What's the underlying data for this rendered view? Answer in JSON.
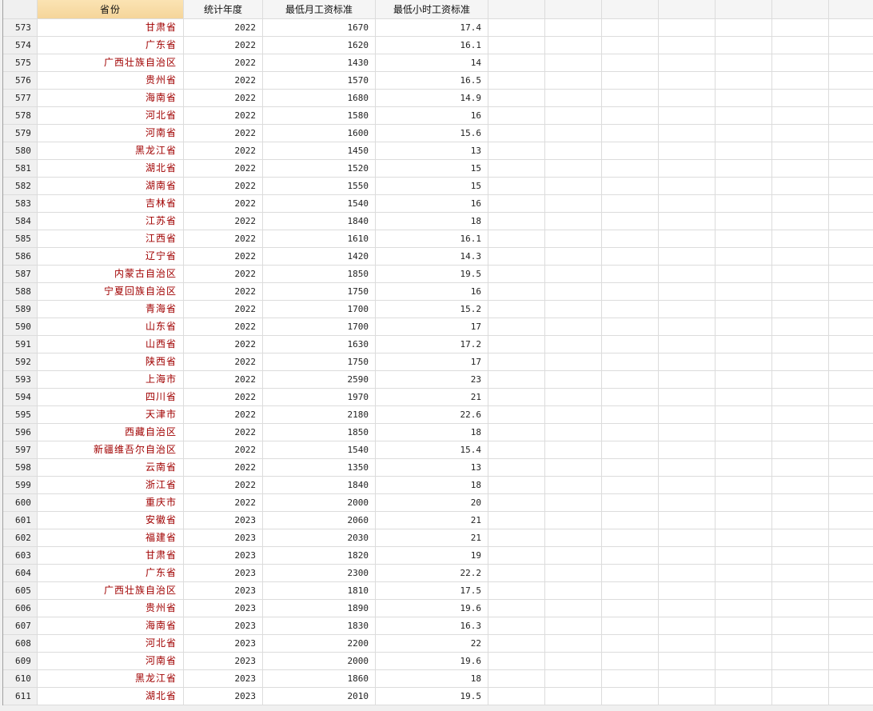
{
  "columns": [
    "省份",
    "统计年度",
    "最低月工资标准",
    "最低小时工资标准"
  ],
  "selected_column": 0,
  "empty_columns": 7,
  "colors": {
    "province_text": "#a00000",
    "selected_header": "#f8dca6"
  },
  "rows": [
    [
      "573",
      "甘肃省",
      "2022",
      "1670",
      "17.4"
    ],
    [
      "574",
      "广东省",
      "2022",
      "1620",
      "16.1"
    ],
    [
      "575",
      "广西壮族自治区",
      "2022",
      "1430",
      "14"
    ],
    [
      "576",
      "贵州省",
      "2022",
      "1570",
      "16.5"
    ],
    [
      "577",
      "海南省",
      "2022",
      "1680",
      "14.9"
    ],
    [
      "578",
      "河北省",
      "2022",
      "1580",
      "16"
    ],
    [
      "579",
      "河南省",
      "2022",
      "1600",
      "15.6"
    ],
    [
      "580",
      "黑龙江省",
      "2022",
      "1450",
      "13"
    ],
    [
      "581",
      "湖北省",
      "2022",
      "1520",
      "15"
    ],
    [
      "582",
      "湖南省",
      "2022",
      "1550",
      "15"
    ],
    [
      "583",
      "吉林省",
      "2022",
      "1540",
      "16"
    ],
    [
      "584",
      "江苏省",
      "2022",
      "1840",
      "18"
    ],
    [
      "585",
      "江西省",
      "2022",
      "1610",
      "16.1"
    ],
    [
      "586",
      "辽宁省",
      "2022",
      "1420",
      "14.3"
    ],
    [
      "587",
      "内蒙古自治区",
      "2022",
      "1850",
      "19.5"
    ],
    [
      "588",
      "宁夏回族自治区",
      "2022",
      "1750",
      "16"
    ],
    [
      "589",
      "青海省",
      "2022",
      "1700",
      "15.2"
    ],
    [
      "590",
      "山东省",
      "2022",
      "1700",
      "17"
    ],
    [
      "591",
      "山西省",
      "2022",
      "1630",
      "17.2"
    ],
    [
      "592",
      "陕西省",
      "2022",
      "1750",
      "17"
    ],
    [
      "593",
      "上海市",
      "2022",
      "2590",
      "23"
    ],
    [
      "594",
      "四川省",
      "2022",
      "1970",
      "21"
    ],
    [
      "595",
      "天津市",
      "2022",
      "2180",
      "22.6"
    ],
    [
      "596",
      "西藏自治区",
      "2022",
      "1850",
      "18"
    ],
    [
      "597",
      "新疆维吾尔自治区",
      "2022",
      "1540",
      "15.4"
    ],
    [
      "598",
      "云南省",
      "2022",
      "1350",
      "13"
    ],
    [
      "599",
      "浙江省",
      "2022",
      "1840",
      "18"
    ],
    [
      "600",
      "重庆市",
      "2022",
      "2000",
      "20"
    ],
    [
      "601",
      "安徽省",
      "2023",
      "2060",
      "21"
    ],
    [
      "602",
      "福建省",
      "2023",
      "2030",
      "21"
    ],
    [
      "603",
      "甘肃省",
      "2023",
      "1820",
      "19"
    ],
    [
      "604",
      "广东省",
      "2023",
      "2300",
      "22.2"
    ],
    [
      "605",
      "广西壮族自治区",
      "2023",
      "1810",
      "17.5"
    ],
    [
      "606",
      "贵州省",
      "2023",
      "1890",
      "19.6"
    ],
    [
      "607",
      "海南省",
      "2023",
      "1830",
      "16.3"
    ],
    [
      "608",
      "河北省",
      "2023",
      "2200",
      "22"
    ],
    [
      "609",
      "河南省",
      "2023",
      "2000",
      "19.6"
    ],
    [
      "610",
      "黑龙江省",
      "2023",
      "1860",
      "18"
    ],
    [
      "611",
      "湖北省",
      "2023",
      "2010",
      "19.5"
    ]
  ]
}
